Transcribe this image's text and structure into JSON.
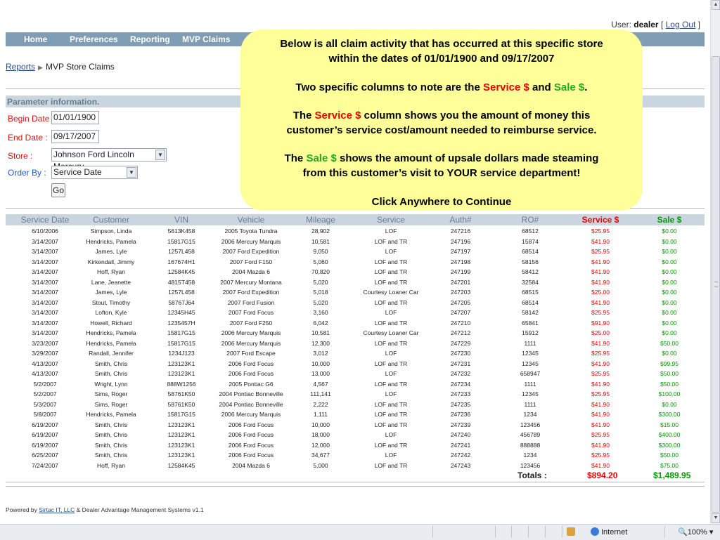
{
  "user_bar": {
    "label": "User:",
    "username": "dealer",
    "logout": "Log Out"
  },
  "nav": [
    "Home",
    "Preferences",
    "Reporting",
    "MVP Claims"
  ],
  "breadcrumb": {
    "parent": "Reports",
    "current": "MVP Store Claims"
  },
  "params": {
    "header": "Parameter information.",
    "begin_label": "Begin Date :",
    "begin_value": "01/01/1900",
    "end_label": "End Date :",
    "end_value": "09/17/2007",
    "store_label": "Store :",
    "store_value": "Johnson Ford Lincoln Mercury",
    "order_label": "Order By :",
    "order_value": "Service Date",
    "go": "Go"
  },
  "columns": [
    "Service Date",
    "Customer",
    "VIN",
    "Vehicle",
    "Mileage",
    "Service",
    "Auth#",
    "RO#",
    "Service $",
    "Sale $"
  ],
  "rows": [
    [
      "6/10/2006",
      "Simpson, Linda",
      "5613K458",
      "2005 Toyota Tundra",
      "28,902",
      "LOF",
      "247216",
      "68512",
      "$25.95",
      "$0.00"
    ],
    [
      "3/14/2007",
      "Hendricks, Pamela",
      "15817G15",
      "2006 Mercury Marquis",
      "10,581",
      "LOF and TR",
      "247196",
      "15874",
      "$41.90",
      "$0.00"
    ],
    [
      "3/14/2007",
      "James, Lyle",
      "1257L458",
      "2007 Ford Expedition",
      "9,050",
      "LOF",
      "247197",
      "68514",
      "$25.95",
      "$0.00"
    ],
    [
      "3/14/2007",
      "Kirkendall, Jimmy",
      "167674H1",
      "2007 Ford F150",
      "5,060",
      "LOF and TR",
      "247198",
      "58156",
      "$41.90",
      "$0.00"
    ],
    [
      "3/14/2007",
      "Hoff, Ryan",
      "12584K45",
      "2004 Mazda 6",
      "70,820",
      "LOF and TR",
      "247199",
      "58412",
      "$41.90",
      "$0.00"
    ],
    [
      "3/14/2007",
      "Lane, Jeanette",
      "4815T458",
      "2007 Mercury Montana",
      "5,020",
      "LOF and TR",
      "247201",
      "32584",
      "$41.90",
      "$0.00"
    ],
    [
      "3/14/2007",
      "James, Lyle",
      "1257L458",
      "2007 Ford Expedition",
      "5,018",
      "Courtesy Loaner Car",
      "247203",
      "68515",
      "$25.00",
      "$0.00"
    ],
    [
      "3/14/2007",
      "Stout, Timothy",
      "58767J64",
      "2007 Ford Fusion",
      "5,020",
      "LOF and TR",
      "247205",
      "68514",
      "$41.90",
      "$0.00"
    ],
    [
      "3/14/2007",
      "Lofton, Kyle",
      "12345H45",
      "2007 Ford Focus",
      "3,160",
      "LOF",
      "247207",
      "58142",
      "$25.95",
      "$0.00"
    ],
    [
      "3/14/2007",
      "Howell, Richard",
      "1235457H",
      "2007 Ford F250",
      "6,042",
      "LOF and TR",
      "247210",
      "65841",
      "$91.90",
      "$0.00"
    ],
    [
      "3/14/2007",
      "Hendricks, Pamela",
      "15817G15",
      "2006 Mercury Marquis",
      "10,581",
      "Courtesy Loaner Car",
      "247212",
      "15912",
      "$25.00",
      "$0.00"
    ],
    [
      "3/23/2007",
      "Hendricks, Pamela",
      "15817G15",
      "2006 Mercury Marquis",
      "12,300",
      "LOF and TR",
      "247229",
      "1111",
      "$41.90",
      "$50.00"
    ],
    [
      "3/29/2007",
      "Randall, Jennifer",
      "1234J123",
      "2007 Ford Escape",
      "3,012",
      "LOF",
      "247230",
      "12345",
      "$25.95",
      "$0.00"
    ],
    [
      "4/13/2007",
      "Smith, Chris",
      "123123K1",
      "2006 Ford Focus",
      "10,000",
      "LOF and TR",
      "247231",
      "12345",
      "$41.90",
      "$99.95"
    ],
    [
      "4/13/2007",
      "Smith, Chris",
      "123123K1",
      "2006 Ford Focus",
      "13,000",
      "LOF",
      "247232",
      "658947",
      "$25.95",
      "$50.00"
    ],
    [
      "5/2/2007",
      "Wright, Lynn",
      "888W1256",
      "2005 Pontiac G6",
      "4,567",
      "LOF and TR",
      "247234",
      "1111",
      "$41.90",
      "$50.00"
    ],
    [
      "5/2/2007",
      "Sims, Roger",
      "58761K50",
      "2004 Pontiac Bonneville",
      "111,141",
      "LOF",
      "247233",
      "12345",
      "$25.95",
      "$100.00"
    ],
    [
      "5/3/2007",
      "Sims, Roger",
      "58761K50",
      "2004 Pontiac Bonneville",
      "2,222",
      "LOF and TR",
      "247235",
      "1111",
      "$41.90",
      "$0.00"
    ],
    [
      "5/8/2007",
      "Hendricks, Pamela",
      "15817G15",
      "2006 Mercury Marquis",
      "1,111",
      "LOF and TR",
      "247236",
      "1234",
      "$41.90",
      "$300.00"
    ],
    [
      "6/19/2007",
      "Smith, Chris",
      "123123K1",
      "2006 Ford Focus",
      "10,000",
      "LOF and TR",
      "247239",
      "123456",
      "$41.90",
      "$15.00"
    ],
    [
      "6/19/2007",
      "Smith, Chris",
      "123123K1",
      "2006 Ford Focus",
      "18,000",
      "LOF",
      "247240",
      "456789",
      "$25.95",
      "$400.00"
    ],
    [
      "6/19/2007",
      "Smith, Chris",
      "123123K1",
      "2006 Ford Focus",
      "12,000",
      "LOF and TR",
      "247241",
      "888888",
      "$41.90",
      "$300.00"
    ],
    [
      "6/25/2007",
      "Smith, Chris",
      "123123K1",
      "2006 Ford Focus",
      "34,677",
      "LOF",
      "247242",
      "1234",
      "$25.95",
      "$50.00"
    ],
    [
      "7/24/2007",
      "Hoff, Ryan",
      "12584K45",
      "2004 Mazda 6",
      "5,000",
      "LOF and TR",
      "247243",
      "123456",
      "$41.90",
      "$75.00"
    ]
  ],
  "totals": {
    "label": "Totals :",
    "service": "$894.20",
    "sale": "$1,489.95"
  },
  "footer": {
    "prefix": "Powered by ",
    "link": "Sirtac IT, LLC",
    "suffix": " & Dealer Advantage Management Systems v1.1"
  },
  "callout": {
    "l1": "Below is all claim activity that has occurred at this specific store",
    "l2": "within the dates of 01/01/1900 and 09/17/2007",
    "l3a": "Two specific columns to note are the ",
    "l3b": "Service $",
    "l3c": " and ",
    "l3d": "Sale $",
    "l3e": ".",
    "l4a": "The ",
    "l4b": "Service $",
    "l4c": " column shows you the amount of money this",
    "l5": "customer’s service cost/amount needed to reimburse service.",
    "l6a": "The ",
    "l6b": "Sale $",
    "l6c": " shows the amount of upsale dollars made steaming",
    "l7": "from this customer’s visit to YOUR service department!",
    "l8": "Click Anywhere to Continue"
  },
  "statusbar": {
    "zone": "Internet",
    "zoom": "100%"
  },
  "colors": {
    "nav": "#7f9db4",
    "grid_header": "#c9d6e0",
    "service": "#e00000",
    "sale": "#009900",
    "callout": "#ffff99"
  }
}
